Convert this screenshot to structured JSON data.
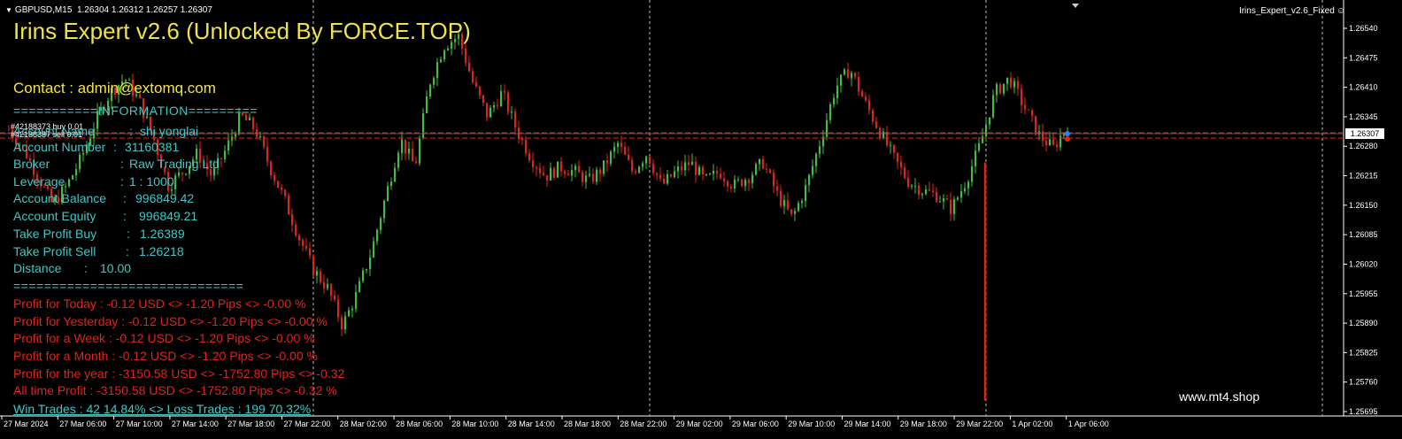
{
  "header": {
    "symbol_tf": "GBPUSD,M15",
    "ohlc": "1.26304 1.26312 1.26257 1.26307"
  },
  "ea_label": "Irins_Expert_v2.6_Fixed",
  "panel": {
    "title": "Irins Expert v2.6 (Unlocked By FORCE.TOP)",
    "contact": "Contact : admin@extomq.com",
    "info_header": "===========INFORMATION=========",
    "trade_tag_1": "#42188373 buy 0.01",
    "trade_tag_2": "#42188387 sell 0.01",
    "rows": [
      {
        "label": "Account Name",
        "sep": ":",
        "value": "shi yonglai"
      },
      {
        "label": "Account Number",
        "sep": ":",
        "value": "31160381"
      },
      {
        "label": "Broker",
        "sep": ":",
        "value": "Raw Trading Ltd"
      },
      {
        "label": "Leverage",
        "sep": ":",
        "value": "1 : 1000"
      },
      {
        "label": "Account Balance",
        "sep": ":",
        "value": "996849.42"
      },
      {
        "label": "Account Equity",
        "sep": ":",
        "value": "996849.21"
      },
      {
        "label": "Take Profit Buy",
        "sep": ":",
        "value": "1.26389"
      },
      {
        "label": "Take Profit Sell",
        "sep": ":",
        "value": "1.26218"
      },
      {
        "label": "Distance",
        "sep": ":",
        "value": "10.00"
      }
    ],
    "divider": "==============================",
    "profits": [
      "Profit for Today  :  -0.12 USD <> -1.20 Pips <> -0.00 %",
      "Profit for Yesterday :  -0.12 USD <> -1.20 Pips <> -0.00 %",
      "Profit for a Week :  -0.12 USD <> -1.20 Pips <> -0.00 %",
      "Profit for a Month :  -0.12 USD <> -1.20 Pips <> -0.00 %",
      "Profit for the year :  -3150.58 USD <> -1752.80 Pips <> -0.32",
      "All time Profit :  -3150.58 USD <> -1752.80 Pips <> -0.32 %"
    ],
    "win_loss": "Win Trades :  42 14.84% <> Loss Trades :  199 70.32%"
  },
  "watermark": "www.mt4.shop",
  "price_axis": [
    "1.26540",
    "1.26475",
    "1.26410",
    "1.26345",
    "1.26280",
    "1.26215",
    "1.26150",
    "1.26085",
    "1.26020",
    "1.25955",
    "1.25890",
    "1.25825",
    "1.25760",
    "1.25695"
  ],
  "current_price": "1.26307",
  "time_axis": [
    "27 Mar 2024",
    "27 Mar 06:00",
    "27 Mar 10:00",
    "27 Mar 14:00",
    "27 Mar 18:00",
    "27 Mar 22:00",
    "28 Mar 02:00",
    "28 Mar 06:00",
    "28 Mar 10:00",
    "28 Mar 14:00",
    "28 Mar 18:00",
    "28 Mar 22:00",
    "29 Mar 02:00",
    "29 Mar 06:00",
    "29 Mar 10:00",
    "29 Mar 14:00",
    "29 Mar 18:00",
    "29 Mar 22:00",
    "1 Apr 02:00",
    "1 Apr 06:00"
  ],
  "colors": {
    "bull": "#3fbf3f",
    "bear": "#e2231a",
    "title": "#f0e24c",
    "info": "#41c7c7",
    "profit": "#e2231a"
  },
  "chart_data": {
    "type": "candlestick",
    "ylim": [
      1.25695,
      1.2657
    ],
    "path": [
      1.263,
      1.2626,
      1.262,
      1.2614,
      1.2618,
      1.2624,
      1.2632,
      1.2638,
      1.2641,
      1.2636,
      1.2628,
      1.2618,
      1.2621,
      1.2625,
      1.262,
      1.2626,
      1.2633,
      1.263,
      1.2622,
      1.2615,
      1.2607,
      1.26,
      1.2596,
      1.2588,
      1.2595,
      1.2604,
      1.2616,
      1.2628,
      1.2622,
      1.264,
      1.2648,
      1.265,
      1.264,
      1.2633,
      1.2638,
      1.263,
      1.2624,
      1.262,
      1.2622,
      1.2621,
      1.2619,
      1.2622,
      1.2627,
      1.2621,
      1.2625,
      1.2618,
      1.2621,
      1.2623,
      1.2619,
      1.2621,
      1.2618,
      1.262,
      1.2623,
      1.2616,
      1.2611,
      1.2618,
      1.2628,
      1.2639,
      1.2643,
      1.2636,
      1.263,
      1.2624,
      1.2619,
      1.2617,
      1.2616,
      1.2613,
      1.2619,
      1.2627,
      1.2638,
      1.2641,
      1.2635,
      1.2629,
      1.2626,
      1.2631
    ]
  }
}
